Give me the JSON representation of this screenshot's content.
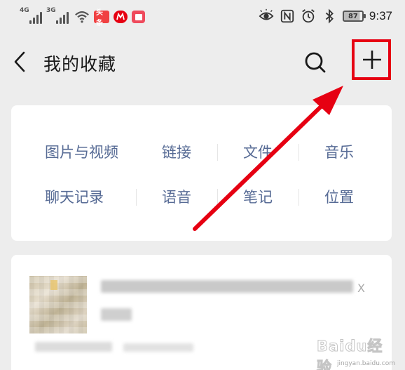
{
  "status_bar": {
    "network_1": "4G",
    "network_2": "3G",
    "toutiao_badge": "头条",
    "battery": "87",
    "time": "9:37"
  },
  "nav": {
    "title": "我的收藏",
    "back_icon": "chevron-left-icon",
    "search_icon": "search-icon",
    "add_icon": "plus-icon"
  },
  "categories": {
    "row1": [
      "图片与视频",
      "链接",
      "文件",
      "音乐"
    ],
    "row2": [
      "聊天记录",
      "语音",
      "笔记",
      "位置"
    ]
  },
  "favorite_item": {
    "title_fragment": "X"
  },
  "watermark": {
    "logo": "Baidu经验",
    "url": "jingyan.baidu.com"
  },
  "colors": {
    "background": "#ededed",
    "card": "#ffffff",
    "category_text": "#576b95",
    "highlight": "#e60012"
  }
}
